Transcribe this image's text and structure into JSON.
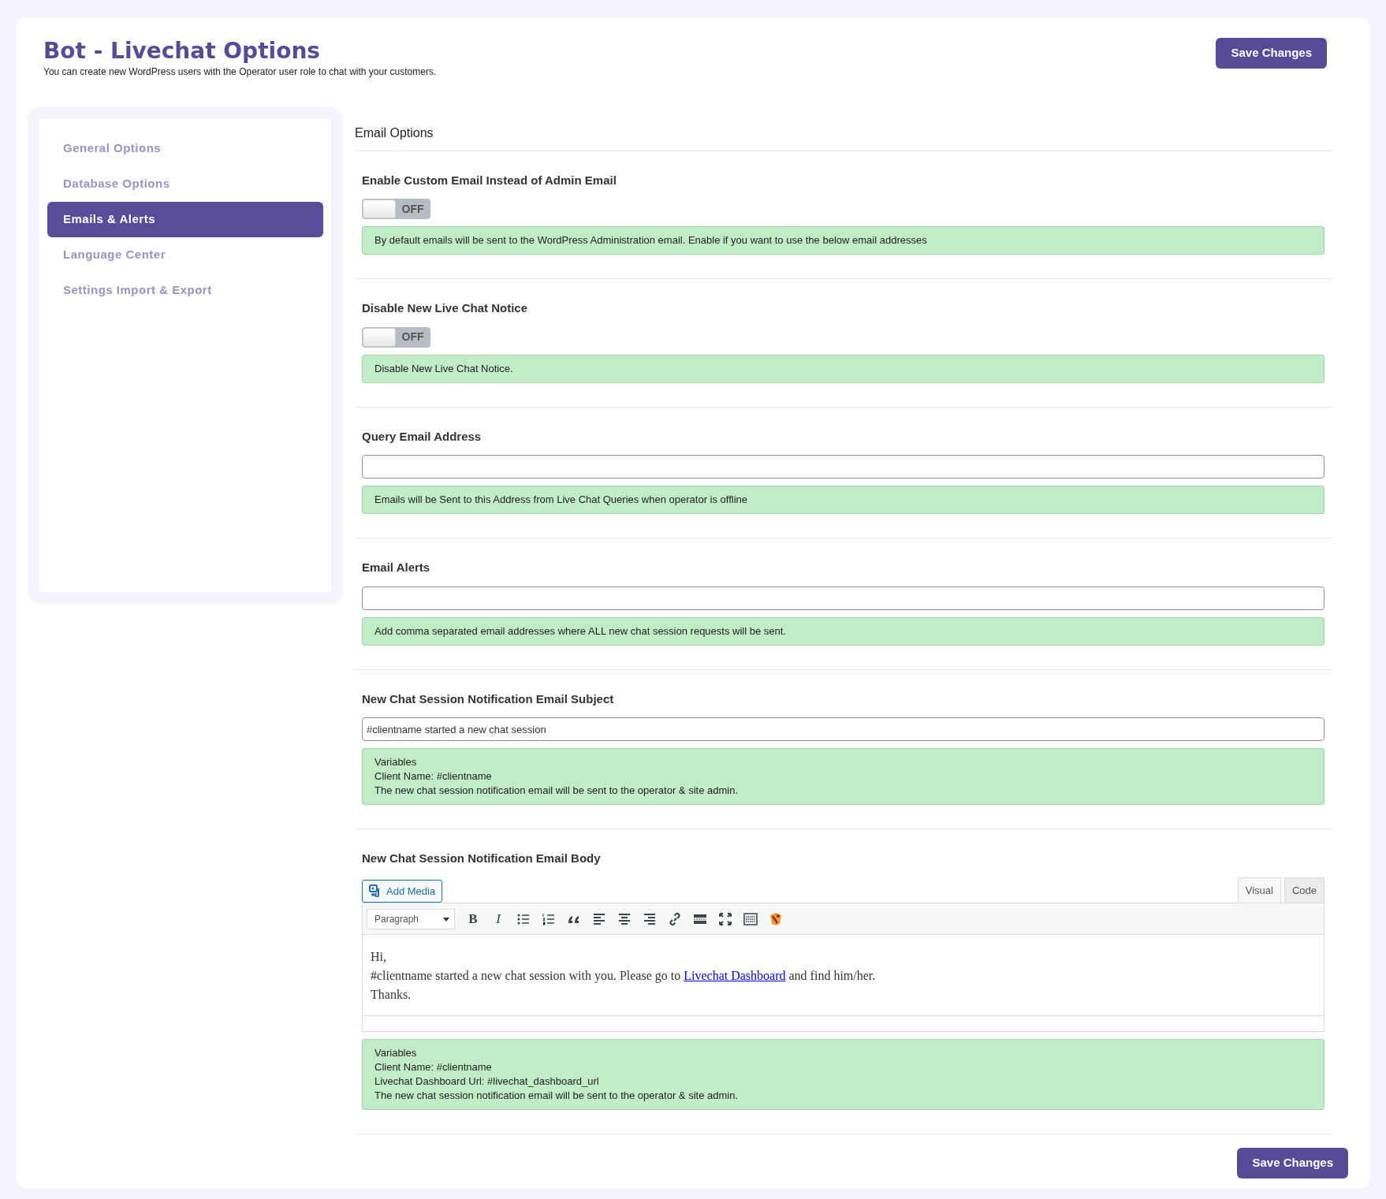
{
  "header": {
    "title": "Bot - Livechat Options",
    "subtitle": "You can create new WordPress users with the Operator user role to chat with your customers.",
    "save_label": "Save Changes"
  },
  "sidebar": {
    "items": [
      {
        "label": "General Options",
        "selected": false
      },
      {
        "label": "Database Options",
        "selected": false
      },
      {
        "label": "Emails & Alerts",
        "selected": true
      },
      {
        "label": "Language Center",
        "selected": false
      },
      {
        "label": "Settings Import & Export",
        "selected": false
      }
    ]
  },
  "panel": {
    "title": "Email Options",
    "sections": [
      {
        "kind": "toggle",
        "label": "Enable Custom Email Instead of Admin Email",
        "on": false,
        "state_label": "OFF",
        "help": [
          "By default emails will be sent to the WordPress Administration email. Enable if you want to use the below email addresses"
        ]
      },
      {
        "kind": "toggle",
        "label": "Disable New Live Chat Notice",
        "on": false,
        "state_label": "OFF",
        "help": [
          "Disable New Live Chat Notice."
        ]
      },
      {
        "kind": "text",
        "label": "Query Email Address",
        "help": [
          "Emails will be Sent to this Address from Live Chat Queries when operator is offline"
        ]
      },
      {
        "kind": "text",
        "label": "Email Alerts",
        "help": [
          "Add comma separated email addresses where ALL new chat session requests will be sent."
        ]
      },
      {
        "kind": "text",
        "label": "New Chat Session Notification Email Subject",
        "value": "#clientname started a new chat session",
        "help": [
          "Variables",
          "Client Name: #clientname",
          "The new chat session notification email will be sent to the operator & site admin."
        ]
      },
      {
        "kind": "editor",
        "label": "New Chat Session Notification Email Body",
        "editor": {
          "add_media": "Add Media",
          "tabs": [
            {
              "label": "Visual",
              "selected": true
            },
            {
              "label": "Code",
              "selected": false
            }
          ],
          "format": "Paragraph",
          "glyphs": [
            {
              "kind": "bold",
              "text": "B"
            },
            {
              "kind": "italic",
              "text": "I"
            }
          ],
          "lines": [
            {
              "text": "Hi,"
            },
            {
              "text": "#clientname started a new chat session with you. Please go to ",
              "link": "Livechat Dashboard",
              "after": " and find him/her."
            },
            {
              "text": "Thanks."
            }
          ]
        },
        "help": [
          "Variables",
          "Client Name: #clientname",
          "Livechat Dashboard Url: #livechat_dashboard_url",
          "The new chat session notification email will be sent to the operator & site admin."
        ]
      }
    ]
  },
  "footer": {
    "save_label": "Save Changes"
  }
}
